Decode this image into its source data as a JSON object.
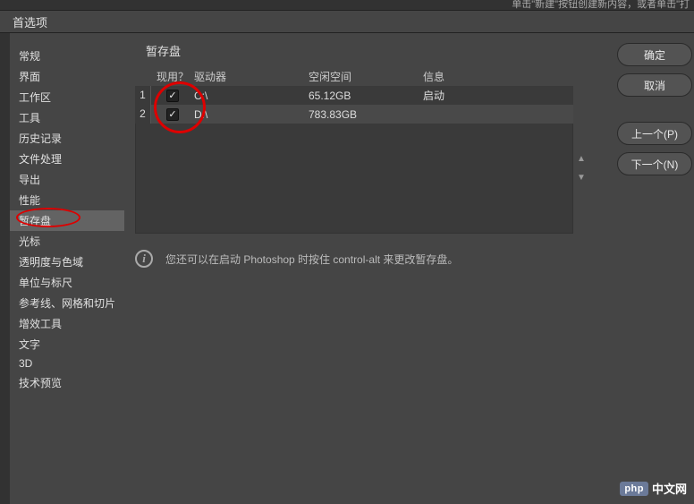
{
  "top_bar": "单击\"新建\"按钮创建新内容，或者单击\"打",
  "window_title": "首选项",
  "sidebar": {
    "items": [
      "常规",
      "界面",
      "工作区",
      "工具",
      "历史记录",
      "文件处理",
      "导出",
      "性能",
      "暂存盘",
      "光标",
      "透明度与色域",
      "单位与标尺",
      "参考线、网格和切片",
      "增效工具",
      "文字",
      "3D",
      "技术预览"
    ],
    "active_index": 8
  },
  "panel": {
    "title": "暂存盘",
    "headers": {
      "active": "现用？",
      "drive": "驱动器",
      "free": "空闲空间",
      "info": "信息"
    },
    "rows": [
      {
        "num": "1",
        "checked": true,
        "drive": "C:\\",
        "free": "65.12GB",
        "info": "启动"
      },
      {
        "num": "2",
        "checked": true,
        "drive": "D:\\",
        "free": "783.83GB",
        "info": ""
      }
    ],
    "hint": "您还可以在启动 Photoshop 时按住 control-alt 来更改暂存盘。"
  },
  "buttons": {
    "ok": "确定",
    "cancel": "取消",
    "prev": "上一个(P)",
    "next": "下一个(N)"
  },
  "watermark": {
    "badge": "php",
    "text": "中文网"
  }
}
